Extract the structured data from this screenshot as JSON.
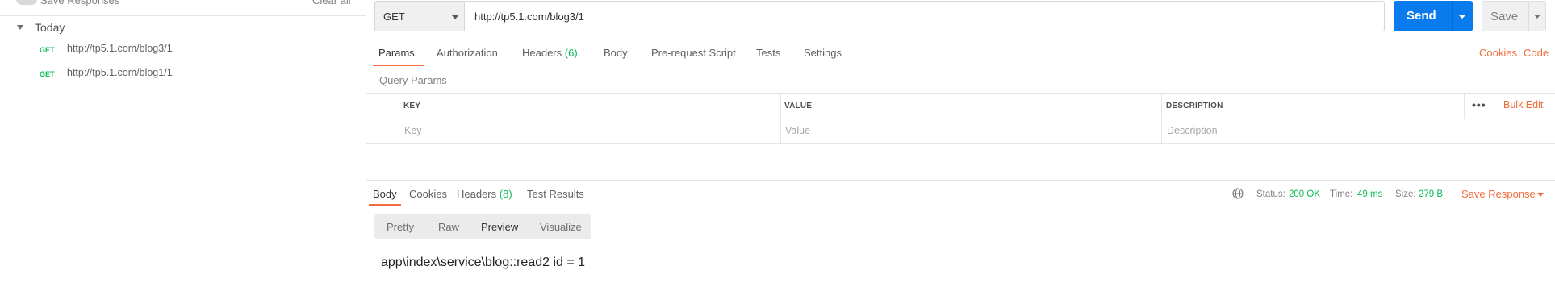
{
  "sidebar": {
    "save_responses_label": "Save Responses",
    "clear_all_label": "Clear all",
    "group_label": "Today",
    "history": [
      {
        "method": "GET",
        "url": "http://tp5.1.com/blog3/1"
      },
      {
        "method": "GET",
        "url": "http://tp5.1.com/blog1/1"
      }
    ]
  },
  "request": {
    "method": "GET",
    "url": "http://tp5.1.com/blog3/1",
    "send_label": "Send",
    "save_label": "Save"
  },
  "request_tabs": {
    "params": "Params",
    "authorization": "Authorization",
    "headers": "Headers",
    "headers_count": "(6)",
    "body": "Body",
    "pre_request_script": "Pre-request Script",
    "tests": "Tests",
    "settings": "Settings",
    "cookies_link": "Cookies",
    "code_link": "Code"
  },
  "query_params": {
    "title": "Query Params",
    "columns": {
      "key": "KEY",
      "value": "VALUE",
      "description": "DESCRIPTION"
    },
    "more": "•••",
    "bulk_edit": "Bulk Edit",
    "placeholders": {
      "key": "Key",
      "value": "Value",
      "description": "Description"
    }
  },
  "response": {
    "tabs": {
      "body": "Body",
      "cookies": "Cookies",
      "headers": "Headers",
      "headers_count": "(8)",
      "test_results": "Test Results"
    },
    "status_label": "Status:",
    "status_value": "200 OK",
    "time_label": "Time:",
    "time_value": "49 ms",
    "size_label": "Size:",
    "size_value": "279 B",
    "save_response_label": "Save Response",
    "view_modes": [
      "Pretty",
      "Raw",
      "Preview",
      "Visualize"
    ],
    "active_view_mode": "Preview",
    "output": "app\\index\\service\\blog::read2 id = 1"
  },
  "colors": {
    "accent": "#f26b3a",
    "send": "#097bed",
    "success": "#0cbb52"
  },
  "icons": [
    "caret-down-icon",
    "globe-icon",
    "chevron-down-icon"
  ]
}
